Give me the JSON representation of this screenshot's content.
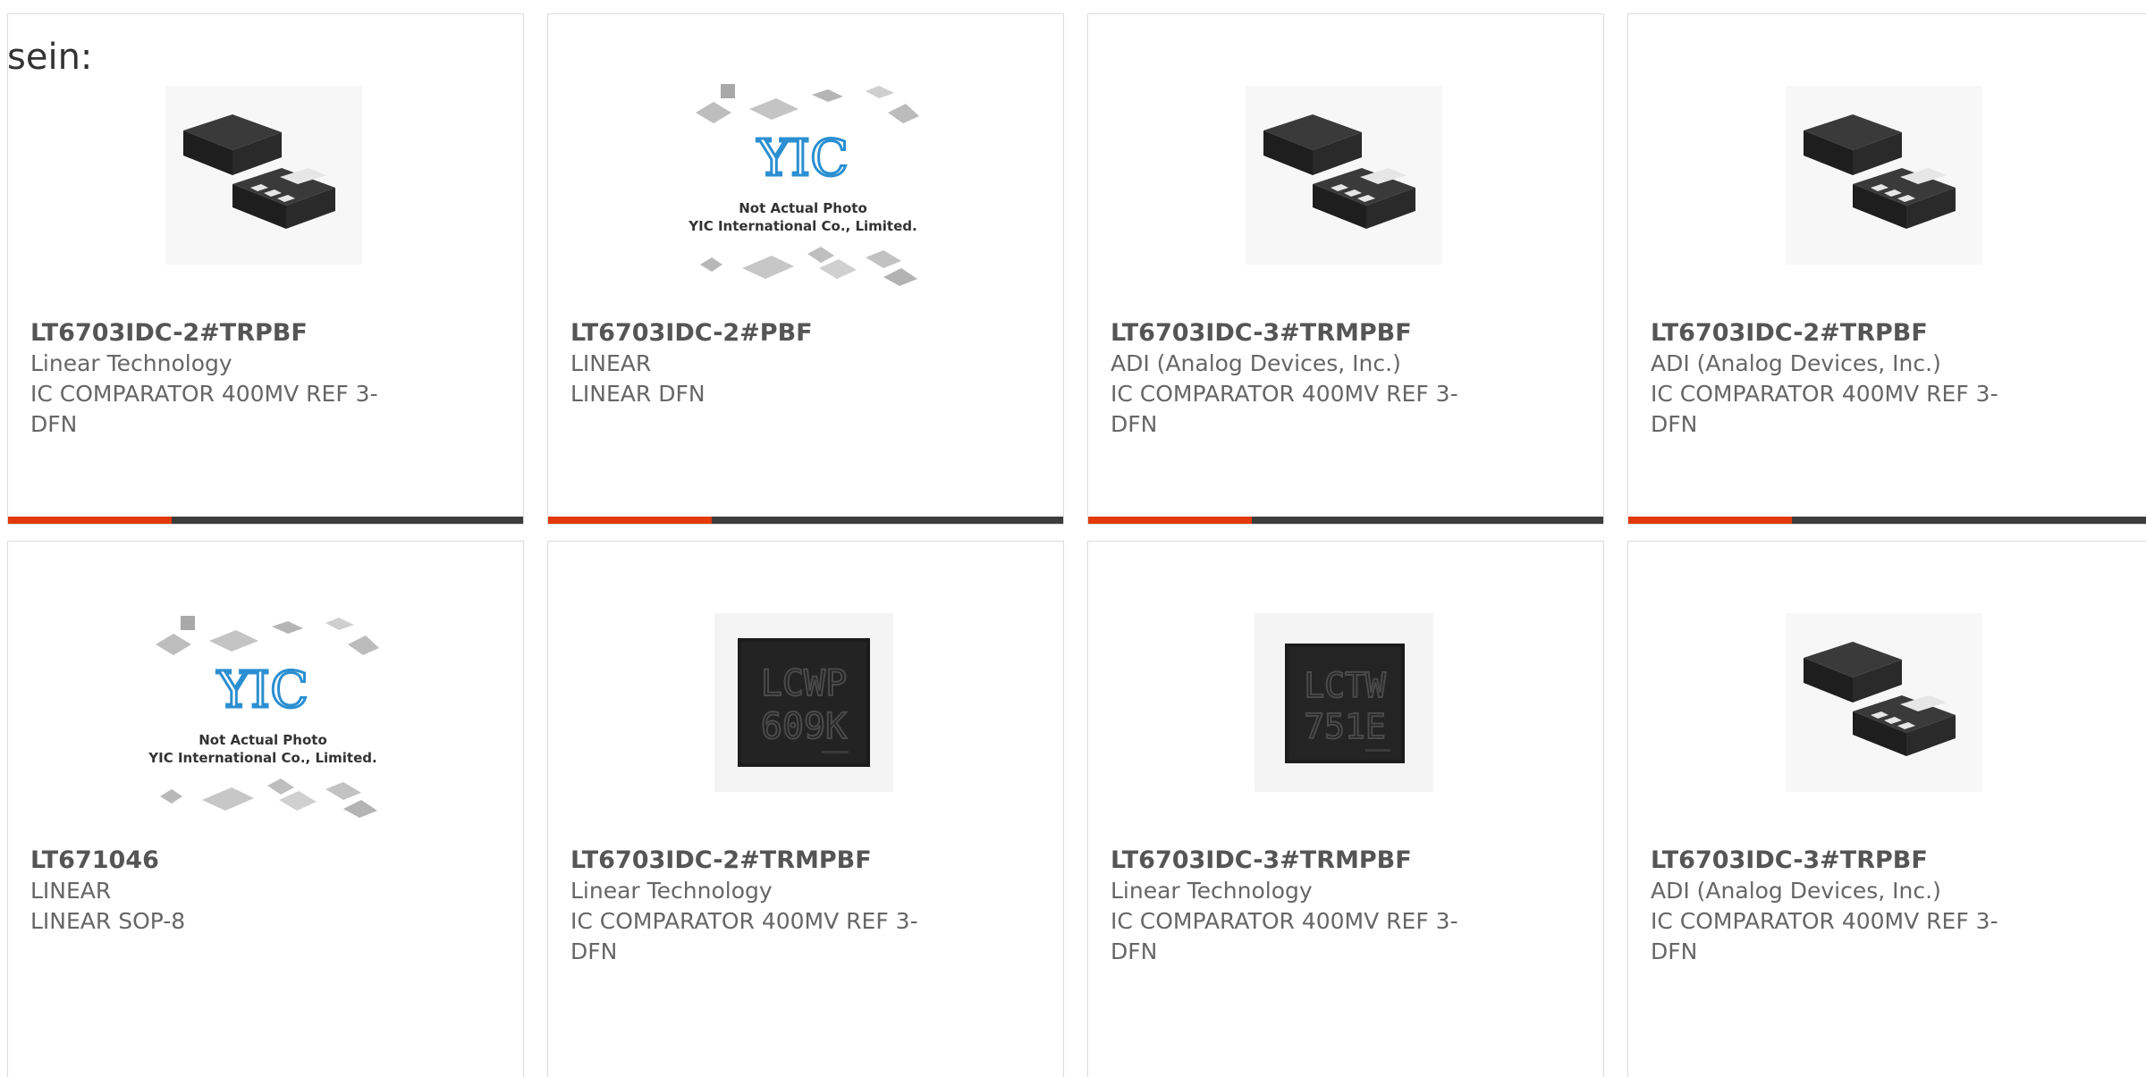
{
  "header": {
    "fragment": "sein:"
  },
  "accent_color": "#e23a0b",
  "products": [
    {
      "part": "LT6703IDC-2#TRPBF",
      "maker": "Linear Technology",
      "desc_line1": "IC COMPARATOR 400MV REF 3-",
      "desc_line2": "DFN",
      "image": "dfn-package-photo"
    },
    {
      "part": "LT6703IDC-2#PBF",
      "maker": "LINEAR",
      "desc_line1": "LINEAR DFN",
      "desc_line2": "",
      "image": "placeholder-photo",
      "placeholder_line1": "Not Actual Photo",
      "placeholder_line2": "YIC International Co., Limited.",
      "placeholder_logo": "YIC"
    },
    {
      "part": "LT6703IDC-3#TRMPBF",
      "maker": "ADI (Analog Devices, Inc.)",
      "desc_line1": "IC COMPARATOR 400MV REF 3-",
      "desc_line2": "DFN",
      "image": "dfn-package-photo"
    },
    {
      "part": "LT6703IDC-2#TRPBF",
      "maker": "ADI (Analog Devices, Inc.)",
      "desc_line1": "IC COMPARATOR 400MV REF 3-",
      "desc_line2": "DFN",
      "image": "dfn-package-photo"
    },
    {
      "part": "LT671046",
      "maker": "LINEAR",
      "desc_line1": "LINEAR SOP-8",
      "desc_line2": "",
      "image": "placeholder-photo",
      "placeholder_line1": "Not Actual Photo",
      "placeholder_line2": "YIC International Co., Limited.",
      "placeholder_logo": "YIC"
    },
    {
      "part": "LT6703IDC-2#TRMPBF",
      "maker": "Linear Technology",
      "desc_line1": "IC COMPARATOR 400MV REF 3-",
      "desc_line2": "DFN",
      "image": "chip-top-photo",
      "chip_line1": "LCWP",
      "chip_line2": "609K"
    },
    {
      "part": "LT6703IDC-3#TRMPBF",
      "maker": "Linear Technology",
      "desc_line1": "IC COMPARATOR 400MV REF 3-",
      "desc_line2": "DFN",
      "image": "chip-top-photo",
      "chip_line1": "LCTW",
      "chip_line2": "751E"
    },
    {
      "part": "LT6703IDC-3#TRPBF",
      "maker": "ADI (Analog Devices, Inc.)",
      "desc_line1": "IC COMPARATOR 400MV REF 3-",
      "desc_line2": "DFN",
      "image": "dfn-package-photo"
    }
  ]
}
